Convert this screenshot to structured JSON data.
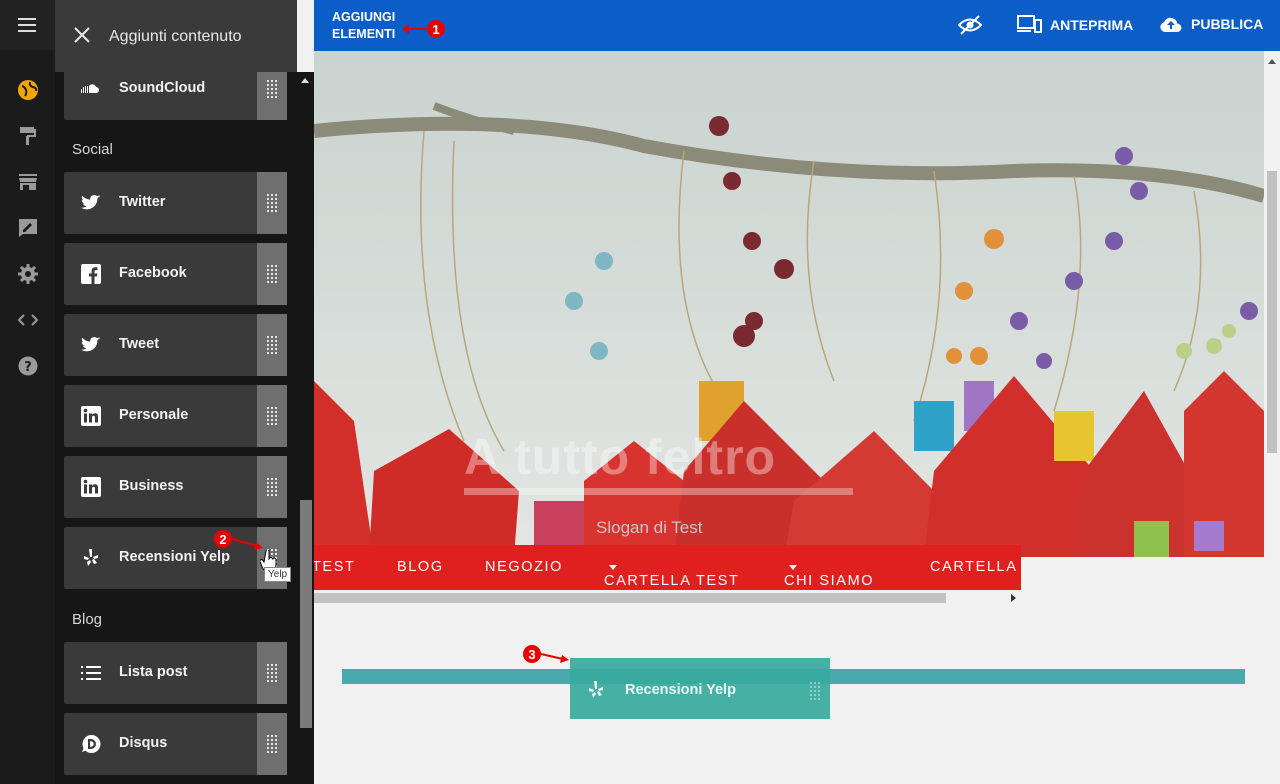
{
  "panel": {
    "title": "Aggiunti contenuto",
    "sections": [
      {
        "label": "Social"
      },
      {
        "label": "Blog"
      }
    ],
    "items": [
      {
        "label": "SoundCloud",
        "icon": "soundcloud-icon"
      },
      {
        "label": "Twitter",
        "icon": "twitter-icon"
      },
      {
        "label": "Facebook",
        "icon": "facebook-icon"
      },
      {
        "label": "Tweet",
        "icon": "twitter-icon"
      },
      {
        "label": "Personale",
        "icon": "linkedin-icon"
      },
      {
        "label": "Business",
        "icon": "linkedin-icon"
      },
      {
        "label": "Recensioni Yelp",
        "icon": "yelp-icon"
      },
      {
        "label": "Lista post",
        "icon": "list-icon"
      },
      {
        "label": "Disqus",
        "icon": "disqus-icon"
      }
    ],
    "tooltip": "Yelp"
  },
  "topbar": {
    "add_line1": "AGGIUNGI",
    "add_line2": "ELEMENTI",
    "preview": "ANTEPRIMA",
    "publish": "PUBBLICA",
    "color": "#0b5ec8"
  },
  "site": {
    "title": "A tutto feltro",
    "slogan": "Slogan di Test",
    "menu": [
      "TEST",
      "BLOG",
      "NEGOZIO",
      "CARTELLA TEST",
      "CHI SIAMO",
      "CARTELLA T"
    ],
    "menu_color": "#e01f1f"
  },
  "drag": {
    "label": "Recensioni Yelp"
  },
  "annotations": [
    "1",
    "2",
    "3"
  ]
}
